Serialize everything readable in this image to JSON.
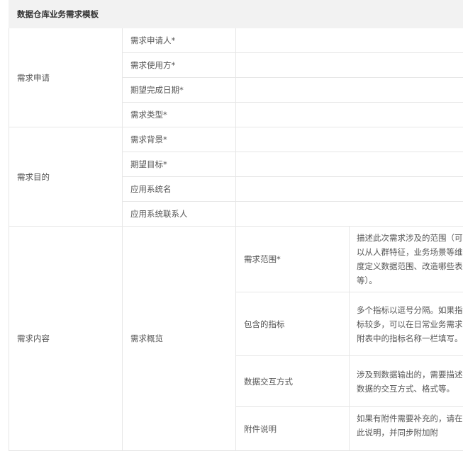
{
  "title": "数据仓库业务需求模板",
  "groups": [
    {
      "name": "需求申请",
      "fields": [
        "需求申请人*",
        "需求使用方*",
        "期望完成日期*",
        "需求类型*"
      ]
    },
    {
      "name": "需求目的",
      "fields": [
        "需求背景*",
        "期望目标*",
        "应用系统名",
        "应用系统联系人"
      ]
    },
    {
      "name": "需求内容",
      "sub": "需求概览",
      "items": [
        {
          "field": "需求范围*",
          "desc": "描述此次需求涉及的范围（可以从人群特征，业务场景等维度定义数据范围、改造哪些表等）。"
        },
        {
          "field": "包含的指标",
          "desc": "多个指标以逗号分隔。如果指标较多，可以在日常业务需求附表中的指标名称一栏填写。"
        },
        {
          "field": "数据交互方式",
          "desc": "涉及到数据输出的，需要描述数据的交互方式、格式等。"
        },
        {
          "field": "附件说明",
          "desc": "如果有附件需要补充的，请在此说明，并同步附加附"
        }
      ]
    }
  ]
}
